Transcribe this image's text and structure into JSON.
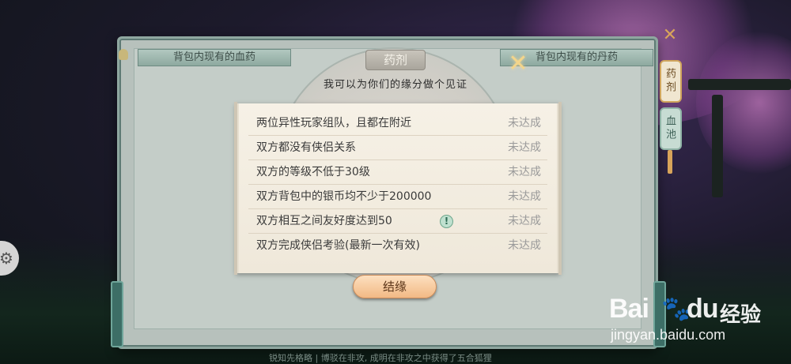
{
  "panel": {
    "left_header": "背包内现有的血药",
    "right_header": "背包内现有的丹药",
    "tab_title": "药剂",
    "subtitle": "我可以为你们的缘分做个见证",
    "close_icon": "close-icon"
  },
  "requirements": [
    {
      "text": "两位异性玩家组队，且都在附近",
      "status": "未达成"
    },
    {
      "text": "双方都没有侠侣关系",
      "status": "未达成"
    },
    {
      "text": "双方的等级不低于30级",
      "status": "未达成"
    },
    {
      "text": "双方背包中的银币均不少于200000",
      "status": "未达成"
    },
    {
      "text": "双方相互之间友好度达到50",
      "status": "未达成",
      "info_icon": "info-icon"
    },
    {
      "text": "双方完成侠侣考验(最新一次有效)",
      "status": "未达成"
    }
  ],
  "bond_button": "结缘",
  "side_tabs": [
    {
      "label": "药剂",
      "active": true
    },
    {
      "label": "血池",
      "active": false
    }
  ],
  "ticker": "锐知先格略 | 博驳在非攻, 成明在非攻之中获得了五合狐狸",
  "watermark": {
    "brand_left": "Bai",
    "brand_right": "du",
    "suffix": "经验",
    "url": "jingyan.baidu.com"
  },
  "colors": {
    "panel_bg": "#b7c1bc",
    "scroll_bg": "#f6f1e6",
    "status_gray": "#9a9a9a",
    "button_accent": "#f2b985"
  }
}
